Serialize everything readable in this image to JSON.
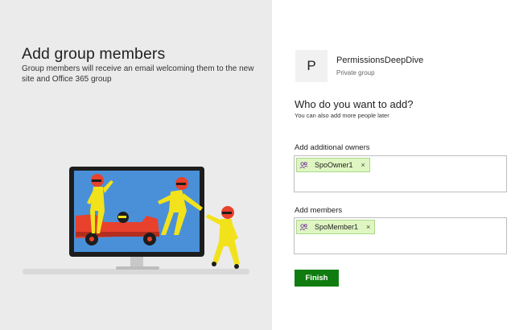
{
  "left": {
    "title": "Add group members",
    "subtitle": "Group members will receive an email welcoming them to the new site and Office 365 group"
  },
  "group": {
    "avatar_letter": "P",
    "name": "PermissionsDeepDive",
    "type": "Private group"
  },
  "question": {
    "title": "Who do you want to add?",
    "subtitle": "You can also add more people later"
  },
  "owners": {
    "label": "Add additional owners",
    "people": [
      {
        "name": "SpoOwner1",
        "remove": "×"
      }
    ]
  },
  "members": {
    "label": "Add members",
    "people": [
      {
        "name": "SpoMember1",
        "remove": "×"
      }
    ]
  },
  "finish_label": "Finish",
  "colors": {
    "left_panel_bg": "#ebebeb",
    "finish_bg": "#107c10",
    "pill_bg": "#dff6c2",
    "screen_blue": "#4a90d9",
    "figure_yellow": "#f2e21b",
    "helmet_red": "#e8412c"
  },
  "icons": {
    "person_pill": "contact-icon",
    "illustration": "racing-team-illustration"
  }
}
